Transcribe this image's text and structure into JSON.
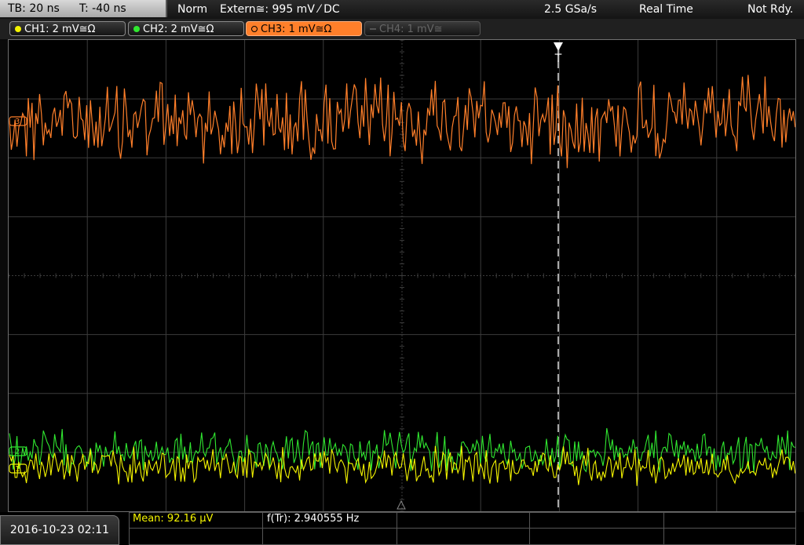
{
  "header": {
    "timebase": "TB: 20 ns",
    "trigger_time": "T: -40 ns",
    "trigger_mode": "Norm",
    "trigger_source": "Extern≅: 995 mV ⁄ DC",
    "sample_rate": "2.5 GSa/s",
    "acquisition_mode": "Real Time",
    "status": "Not Rdy."
  },
  "channels": [
    {
      "label": "CH1: 2 mV≅Ω",
      "color": "#f4f400",
      "active": false,
      "enabled": true
    },
    {
      "label": "CH2: 2 mV≅Ω",
      "color": "#30e830",
      "active": false,
      "enabled": true
    },
    {
      "label": "CH3: 1 mV≅Ω",
      "color": "#ff7f2a",
      "active": true,
      "enabled": true
    },
    {
      "label": "CH4: 1 mV≅",
      "color": "#707070",
      "active": false,
      "enabled": false
    }
  ],
  "waveform_markers": {
    "ch1": "1",
    "ch2": "2",
    "ch3": "3",
    "trigger": "T"
  },
  "footer": {
    "datetime": "2016-10-23 02:11",
    "measurement_mean": "Mean: 92.16 µV",
    "measurement_freq": "f(Tr): 2.940555 Hz"
  },
  "colors": {
    "grid": "#3c3c3c",
    "trigger_line": "#ffffff",
    "ch1": "#f4f400",
    "ch2": "#30e830",
    "ch3": "#ff7f2a"
  }
}
